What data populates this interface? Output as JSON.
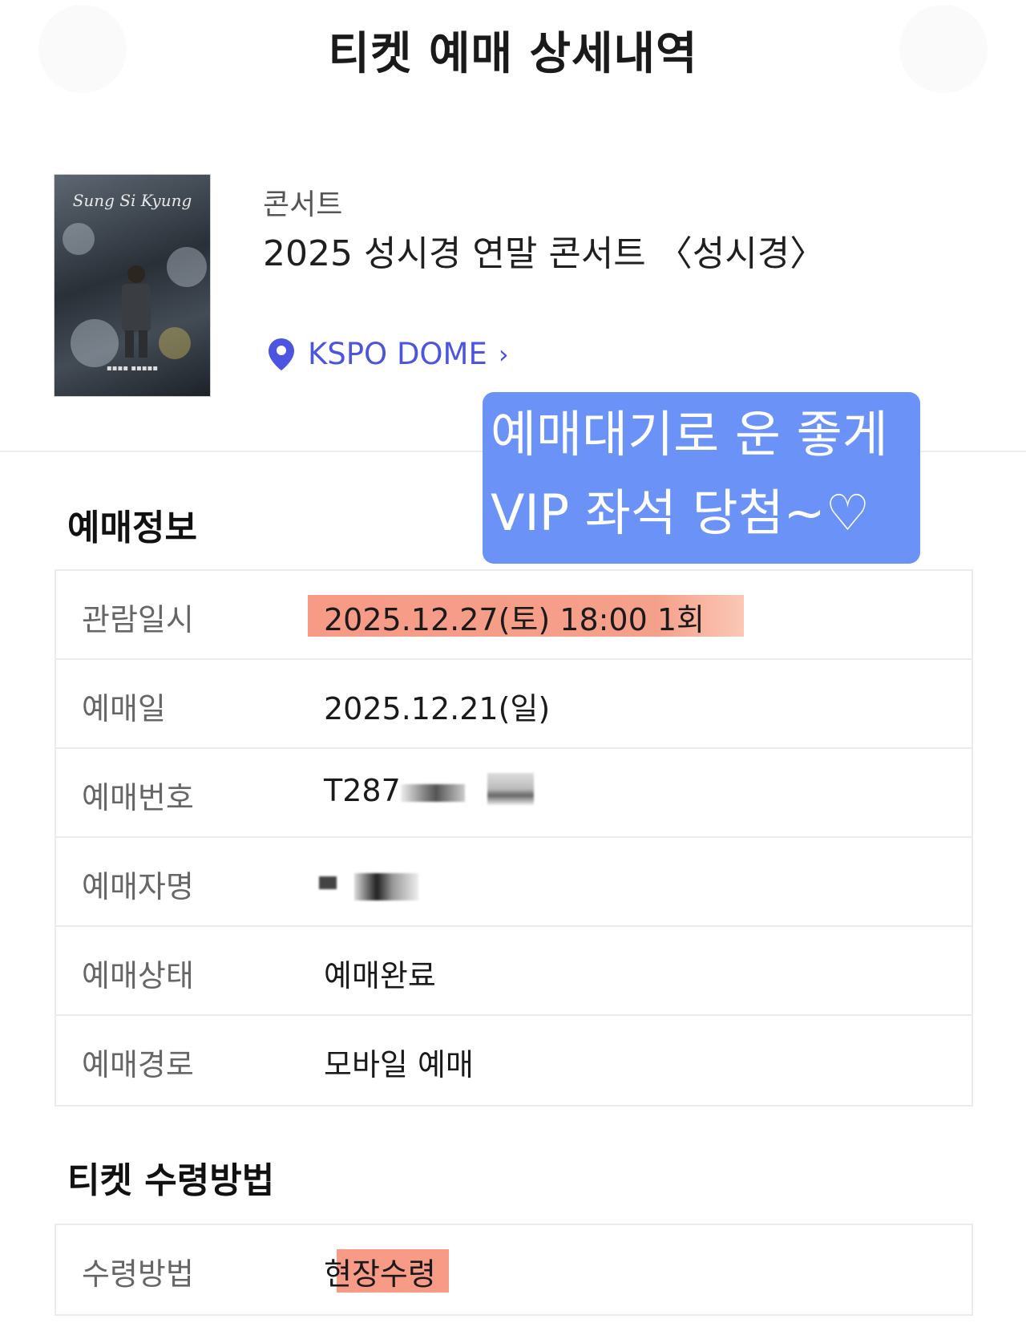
{
  "header": {
    "title": "티켓 예매 상세내역"
  },
  "event": {
    "category": "콘서트",
    "title": "2025 성시경 연말 콘서트 〈성시경〉",
    "venue": "KSPO DOME",
    "venue_chevron": "›",
    "poster_name": "Sung Si Kyung"
  },
  "sticker": {
    "line1": "예매대기로 운 좋게",
    "line2": "VIP 좌석 당첨~♡",
    "color": "#6b92f6"
  },
  "booking_info": {
    "section_title": "예매정보",
    "rows": [
      {
        "label": "관람일시",
        "value": "2025.12.27(토) 18:00 1회"
      },
      {
        "label": "예매일",
        "value": "2025.12.21(일)"
      },
      {
        "label": "예매번호",
        "value": "T287"
      },
      {
        "label": "예매자명",
        "value": ""
      },
      {
        "label": "예매상태",
        "value": "예매완료"
      },
      {
        "label": "예매경로",
        "value": "모바일 예매"
      }
    ]
  },
  "pickup": {
    "section_title": "티켓 수령방법",
    "rows": [
      {
        "label": "수령방법",
        "value": "현장수령"
      }
    ]
  },
  "colors": {
    "accent": "#4b55e0",
    "highlight": "#f79a86"
  }
}
